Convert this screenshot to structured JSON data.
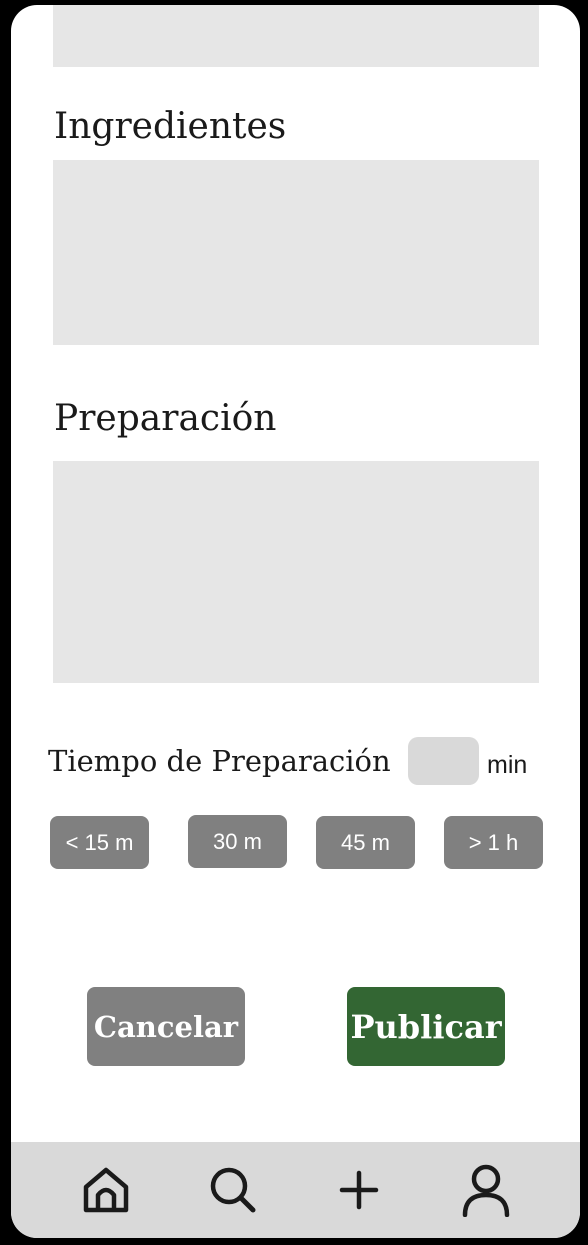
{
  "form": {
    "ingredients_title": "Ingredientes",
    "preparation_title": "Preparación",
    "ingredients_value": "",
    "preparation_value": ""
  },
  "time": {
    "label": "Tiempo de Preparación",
    "value": "",
    "unit": "min",
    "options": [
      "< 15 m",
      "30 m",
      "45 m",
      "> 1 h"
    ]
  },
  "actions": {
    "cancel_label": "Cancelar",
    "publish_label": "Publicar"
  },
  "nav": {
    "items": [
      {
        "icon": "home-icon"
      },
      {
        "icon": "search-icon"
      },
      {
        "icon": "plus-icon"
      },
      {
        "icon": "user-icon"
      }
    ]
  },
  "colors": {
    "background": "#000000",
    "surface": "#ffffff",
    "field": "#e6e6e6",
    "chip": "#808080",
    "primary": "#336633",
    "nav_bar": "#d9d9d9"
  }
}
